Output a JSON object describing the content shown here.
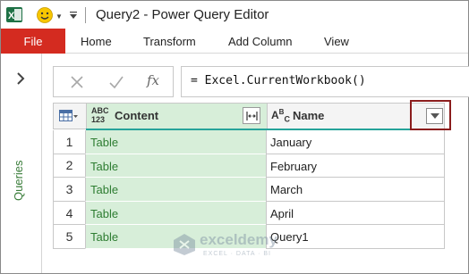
{
  "window": {
    "title": "Query2 - Power Query Editor"
  },
  "ribbon": {
    "tabs": [
      "File",
      "Home",
      "Transform",
      "Add Column",
      "View"
    ]
  },
  "sidebar": {
    "label": "Queries"
  },
  "formula_bar": {
    "fx_label": "fx",
    "formula": "= Excel.CurrentWorkbook()"
  },
  "table": {
    "columns": [
      {
        "type_label": "ABC\n123",
        "name": "Content"
      },
      {
        "type_label": "ABC",
        "name": "Name"
      }
    ],
    "rows": [
      {
        "num": "1",
        "content": "Table",
        "name": "January"
      },
      {
        "num": "2",
        "content": "Table",
        "name": "February"
      },
      {
        "num": "3",
        "content": "Table",
        "name": "March"
      },
      {
        "num": "4",
        "content": "Table",
        "name": "April"
      },
      {
        "num": "5",
        "content": "Table",
        "name": "Query1"
      }
    ]
  },
  "watermark": {
    "name": "exceldemy",
    "tagline": "EXCEL · DATA · BI"
  },
  "colors": {
    "file_tab": "#d42b20",
    "content_column": "#d7eed9",
    "quality_bar": "#26a39a",
    "highlight_box": "#8b1d1d"
  }
}
